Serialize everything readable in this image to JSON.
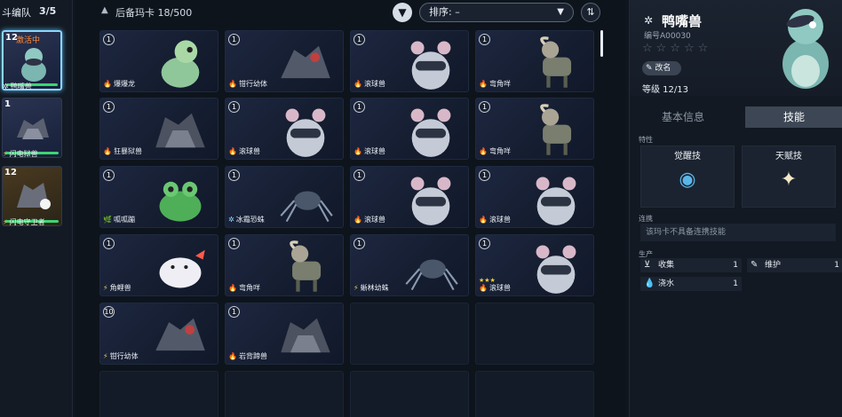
{
  "team": {
    "label": "斗编队",
    "count": "3/5",
    "members": [
      {
        "level": "12",
        "status": "激活中",
        "name": "鸭嘴兽",
        "icon_name": "snowflake-icon"
      },
      {
        "level": "1",
        "status": "",
        "name": "闪电狱兽",
        "icon_name": "lightning-icon"
      },
      {
        "level": "12",
        "status": "",
        "name": "闪电守卫者",
        "icon_name": "lightning-icon"
      }
    ]
  },
  "toolbar": {
    "backup_label": "后备玛卡 18/500",
    "sort_label": "排序: –",
    "filter_icon": "filter-icon",
    "order_icon": "sort-order-icon"
  },
  "cards": [
    {
      "level": "1",
      "name": "爆爆龙",
      "element": "fire",
      "creature": "dino",
      "stars": ""
    },
    {
      "level": "1",
      "name": "钳行幼体",
      "element": "fire",
      "creature": "bug",
      "stars": ""
    },
    {
      "level": "1",
      "name": "滚球兽",
      "element": "fire",
      "creature": "mouse",
      "stars": ""
    },
    {
      "level": "1",
      "name": "弯角咩",
      "element": "fire",
      "creature": "goat",
      "stars": ""
    },
    {
      "level": "1",
      "name": "狂暴狱兽",
      "element": "fire",
      "creature": "beast",
      "stars": ""
    },
    {
      "level": "1",
      "name": "滚球兽",
      "element": "fire",
      "creature": "mouse",
      "stars": ""
    },
    {
      "level": "1",
      "name": "滚球兽",
      "element": "fire",
      "creature": "mouse",
      "stars": ""
    },
    {
      "level": "1",
      "name": "弯角咩",
      "element": "fire",
      "creature": "goat",
      "stars": ""
    },
    {
      "level": "1",
      "name": "呱呱蹦",
      "element": "grass",
      "creature": "frog",
      "stars": ""
    },
    {
      "level": "1",
      "name": "冰霜恐蛛",
      "element": "ice",
      "creature": "spider",
      "stars": ""
    },
    {
      "level": "1",
      "name": "滚球兽",
      "element": "fire",
      "creature": "mouse",
      "stars": ""
    },
    {
      "level": "1",
      "name": "滚球兽",
      "element": "fire",
      "creature": "mouse",
      "stars": ""
    },
    {
      "level": "1",
      "name": "角鲤兽",
      "element": "lightning",
      "creature": "axolotl",
      "stars": ""
    },
    {
      "level": "1",
      "name": "弯角咩",
      "element": "fire",
      "creature": "goat",
      "stars": ""
    },
    {
      "level": "1",
      "name": "蜥林幼蛛",
      "element": "lightning",
      "creature": "spider",
      "stars": ""
    },
    {
      "level": "1",
      "name": "滚球兽",
      "element": "fire",
      "creature": "mouse",
      "stars": "★★★"
    },
    {
      "level": "10",
      "name": "钳行幼体",
      "element": "lightning",
      "creature": "bug",
      "stars": ""
    },
    {
      "level": "1",
      "name": "岩背蹄兽",
      "element": "fire",
      "creature": "beast",
      "stars": ""
    }
  ],
  "detail": {
    "name": "鸭嘴兽",
    "code": "编号A00030",
    "stars": "☆☆☆☆☆",
    "rename": "改名",
    "level": "等级 12/13",
    "tabs": [
      "基本信息",
      "技能"
    ],
    "trait_label": "特性",
    "skills": [
      "觉醒技",
      "天赋技"
    ],
    "combo_label": "连携",
    "combo_text": "该玛卡不具备连携技能",
    "production_label": "生产",
    "production": [
      {
        "icon_name": "basket-icon",
        "label": "收集",
        "value": "1"
      },
      {
        "icon_name": "wrench-icon",
        "label": "维护",
        "value": "1"
      },
      {
        "icon_name": "water-drop-icon",
        "label": "浇水",
        "value": "1"
      }
    ]
  },
  "colors": {
    "fire": "#ff8a3a",
    "grass": "#3ed474",
    "ice": "#8ad7ff",
    "lightning": "#f0d040",
    "accent": "#8ad7ff"
  }
}
